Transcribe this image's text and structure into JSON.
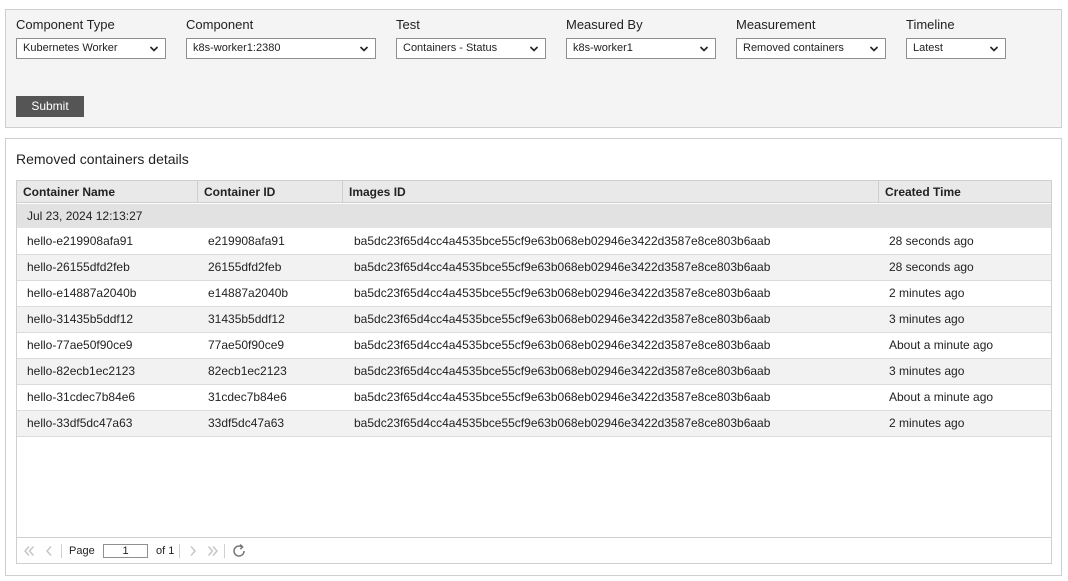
{
  "filters": [
    {
      "label": "Component Type",
      "value": "Kubernetes Worker"
    },
    {
      "label": "Component",
      "value": "k8s-worker1:2380"
    },
    {
      "label": "Test",
      "value": "Containers - Status"
    },
    {
      "label": "Measured By",
      "value": "k8s-worker1"
    },
    {
      "label": "Measurement",
      "value": "Removed containers"
    },
    {
      "label": "Timeline",
      "value": "Latest"
    }
  ],
  "submit_label": "Submit",
  "results": {
    "title": "Removed containers details",
    "columns": [
      "Container Name",
      "Container ID",
      "Images ID",
      "Created Time"
    ],
    "group_label": "Jul 23, 2024 12:13:27",
    "rows": [
      {
        "name": "hello-e219908afa91",
        "id": "e219908afa91",
        "image": "ba5dc23f65d4cc4a4535bce55cf9e63b068eb02946e3422d3587e8ce803b6aab",
        "created": "28 seconds ago"
      },
      {
        "name": "hello-26155dfd2feb",
        "id": "26155dfd2feb",
        "image": "ba5dc23f65d4cc4a4535bce55cf9e63b068eb02946e3422d3587e8ce803b6aab",
        "created": "28 seconds ago"
      },
      {
        "name": "hello-e14887a2040b",
        "id": "e14887a2040b",
        "image": "ba5dc23f65d4cc4a4535bce55cf9e63b068eb02946e3422d3587e8ce803b6aab",
        "created": "2 minutes ago"
      },
      {
        "name": "hello-31435b5ddf12",
        "id": "31435b5ddf12",
        "image": "ba5dc23f65d4cc4a4535bce55cf9e63b068eb02946e3422d3587e8ce803b6aab",
        "created": "3 minutes ago"
      },
      {
        "name": "hello-77ae50f90ce9",
        "id": "77ae50f90ce9",
        "image": "ba5dc23f65d4cc4a4535bce55cf9e63b068eb02946e3422d3587e8ce803b6aab",
        "created": "About a minute ago"
      },
      {
        "name": "hello-82ecb1ec2123",
        "id": "82ecb1ec2123",
        "image": "ba5dc23f65d4cc4a4535bce55cf9e63b068eb02946e3422d3587e8ce803b6aab",
        "created": "3 minutes ago"
      },
      {
        "name": "hello-31cdec7b84e6",
        "id": "31cdec7b84e6",
        "image": "ba5dc23f65d4cc4a4535bce55cf9e63b068eb02946e3422d3587e8ce803b6aab",
        "created": "About a minute ago"
      },
      {
        "name": "hello-33df5dc47a63",
        "id": "33df5dc47a63",
        "image": "ba5dc23f65d4cc4a4535bce55cf9e63b068eb02946e3422d3587e8ce803b6aab",
        "created": "2 minutes ago"
      }
    ]
  },
  "pager": {
    "page_label": "Page",
    "page_value": "1",
    "of_label": "of 1",
    "icons": [
      "first-page-icon",
      "previous-page-icon",
      "next-page-icon",
      "last-page-icon",
      "refresh-icon"
    ]
  },
  "colors": {
    "submit_bg": "#555555",
    "header_bg": "#e9e9e9",
    "group_bg": "#e2e2e2",
    "alt_row_bg": "#f2f2f2",
    "disabled_icon": "#c4c4c4"
  }
}
